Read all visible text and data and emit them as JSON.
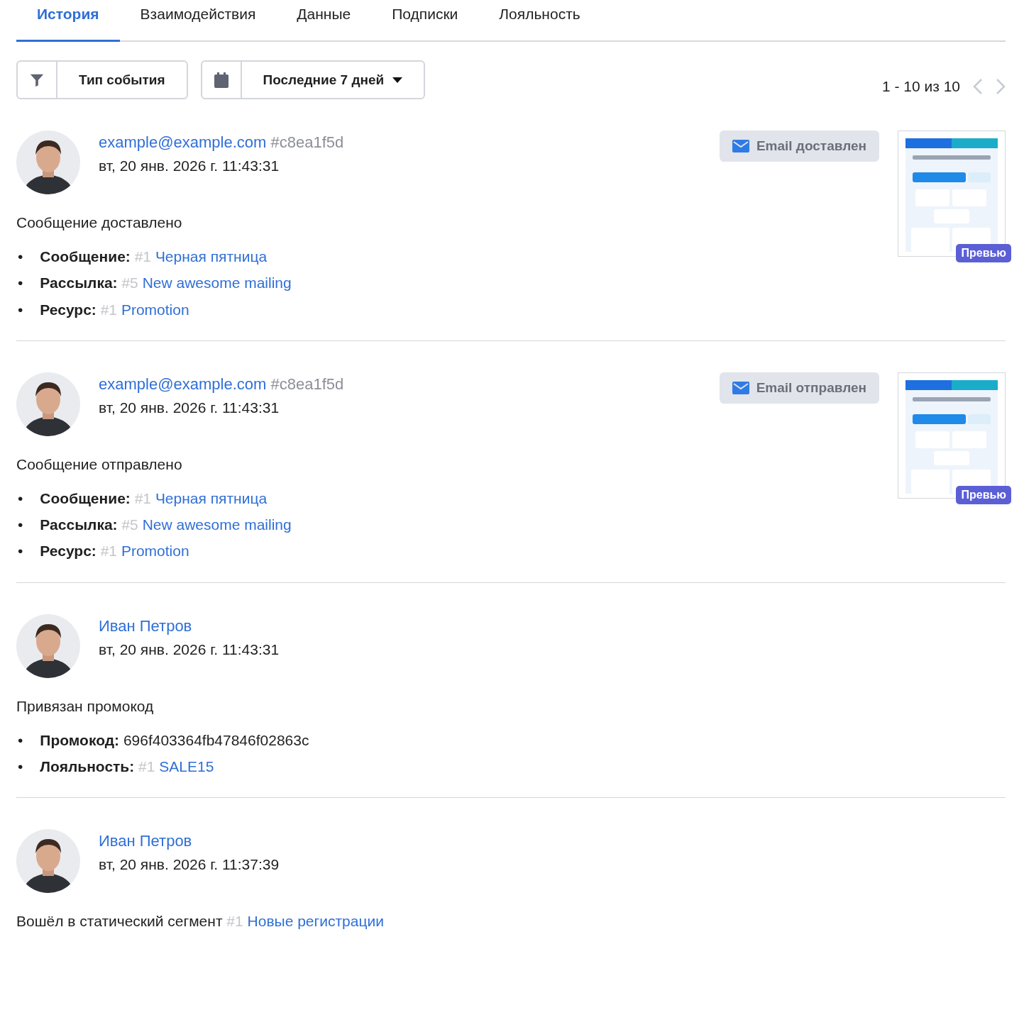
{
  "tabs": [
    {
      "label": "История",
      "selected": true
    },
    {
      "label": "Взаимодействия",
      "selected": false
    },
    {
      "label": "Данные",
      "selected": false
    },
    {
      "label": "Подписки",
      "selected": false
    },
    {
      "label": "Лояльность",
      "selected": false
    }
  ],
  "filters": {
    "event_type": "Тип события",
    "period": "Последние 7 дней"
  },
  "pagination": {
    "range": "1 - 10 из 10",
    "prev_disabled": true,
    "next_disabled": true
  },
  "events": [
    {
      "actor": "example@example.com",
      "actor_id": "#c8ea1f5d",
      "time": "вт, 20 янв. 2026 г. 11:43:31",
      "badge": "Email доставлен",
      "preview": {
        "kind": "picture",
        "label": "Превью"
      },
      "title": "Сообщение доставлено",
      "details": [
        {
          "marker": "•",
          "label": "Сообщение:",
          "ref": "#1",
          "value": "Черная пятница",
          "kind": "link"
        },
        {
          "marker": "•",
          "label": "Рассылка:",
          "ref": "#5",
          "value": "New awesome mailing",
          "kind": "link"
        },
        {
          "marker": "•",
          "label": "Ресурс:",
          "ref": "#1",
          "value": "Promotion",
          "kind": "link"
        }
      ]
    },
    {
      "actor": "example@example.com",
      "actor_id": "#c8ea1f5d",
      "time": "вт, 20 янв. 2026 г. 11:43:31",
      "badge": "Email отправлен",
      "preview": {
        "kind": "picture",
        "label": "Превью"
      },
      "title": "Сообщение отправлено",
      "details": [
        {
          "marker": "•",
          "label": "Сообщение:",
          "ref": "#1",
          "value": "Черная пятница",
          "kind": "link"
        },
        {
          "marker": "•",
          "label": "Рассылка:",
          "ref": "#5",
          "value": "New awesome mailing",
          "kind": "link"
        },
        {
          "marker": "•",
          "label": "Ресурс:",
          "ref": "#1",
          "value": "Promotion",
          "kind": "link"
        }
      ]
    },
    {
      "actor": "Иван Петров",
      "time": "вт, 20 янв. 2026 г. 11:43:31",
      "title": "Привязан промокод",
      "details": [
        {
          "marker": "•",
          "label": "Промокод:",
          "value": "696f403364fb47846f02863c",
          "kind": "plain"
        },
        {
          "marker": "•",
          "label": "Лояльность:",
          "ref": "#1",
          "value": "SALE15",
          "kind": "link"
        }
      ]
    },
    {
      "actor": "Иван Петров",
      "time": "вт, 20 янв. 2026 г. 11:37:39",
      "title": "Вошёл в статический сегмент",
      "title_ref": "#1",
      "title_link": "Новые регистрации"
    }
  ]
}
